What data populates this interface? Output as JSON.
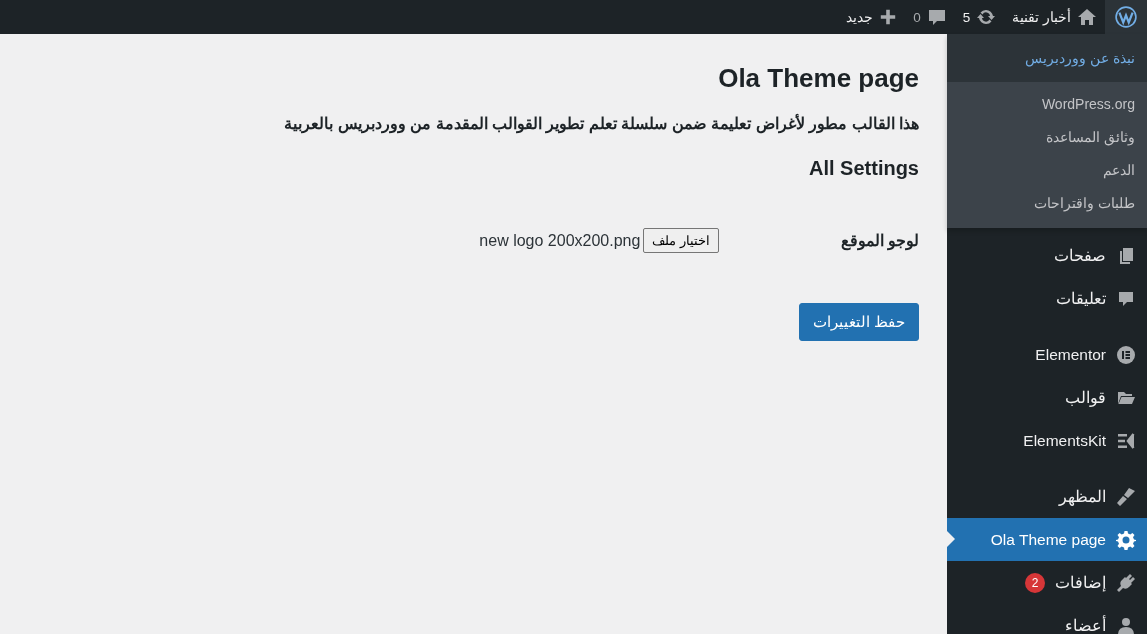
{
  "admin_bar": {
    "site_name": "أخبار تقنية",
    "updates": "5",
    "comments": "0",
    "new_label": "جديد"
  },
  "about_menu": {
    "header": "نبذة عن ووردبريس",
    "items": [
      "WordPress.org",
      "وثائق المساعدة",
      "الدعم",
      "طلبات واقتراحات"
    ]
  },
  "sidebar": {
    "sections": [
      {
        "items": [
          {
            "label": "صفحات",
            "selected": false
          },
          {
            "label": "تعليقات",
            "selected": false
          }
        ]
      },
      {
        "items": [
          {
            "label": "Elementor",
            "selected": false
          },
          {
            "label": "قوالب",
            "selected": false
          },
          {
            "label": "ElementsKit",
            "selected": false
          }
        ]
      },
      {
        "items": [
          {
            "label": "المظهر",
            "selected": false
          },
          {
            "label": "Ola Theme page",
            "selected": true
          },
          {
            "label": "إضافات",
            "selected": false,
            "badge": "2"
          },
          {
            "label": "أعضاء",
            "selected": false
          }
        ]
      }
    ]
  },
  "page": {
    "title": "Ola Theme page",
    "description": "هذا القالب مطور لأغراض تعليمة ضمن سلسلة تعلم تطوير القوالب المقدمة من ووردبريس بالعربية",
    "section_title": "All Settings",
    "fields": [
      {
        "label": "لوجو الموقع",
        "button": "اختيار ملف",
        "file_name": "new logo 200x200.png"
      }
    ],
    "save_button": "حفظ التغييرات"
  }
}
